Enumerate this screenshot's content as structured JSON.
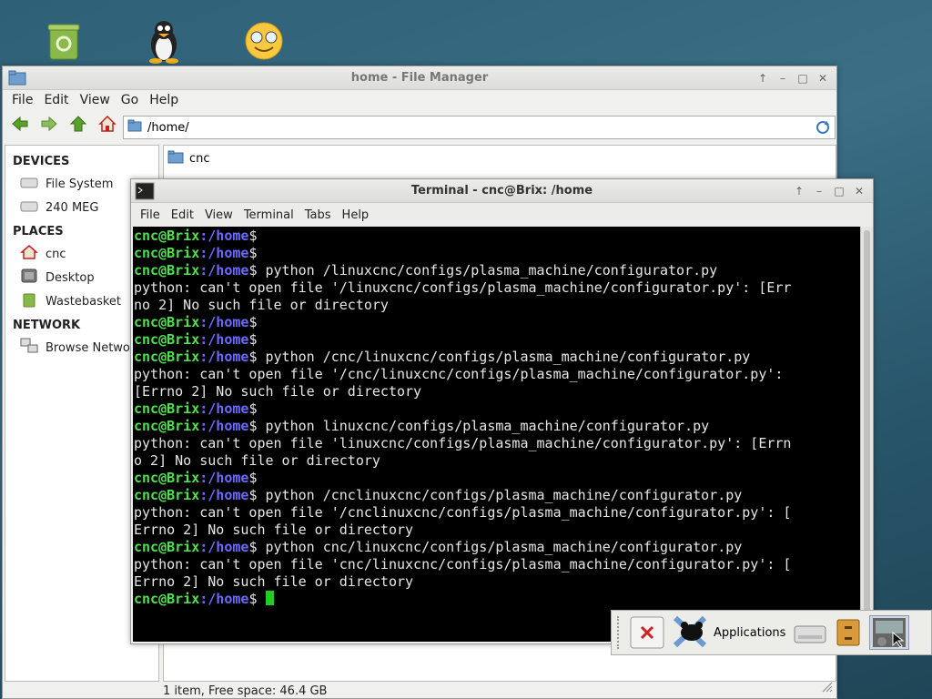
{
  "desktop": {
    "icons": [
      "trash-icon",
      "tux-icon",
      "smiley-icon"
    ]
  },
  "file_manager": {
    "title": "home - File Manager",
    "menu": [
      "File",
      "Edit",
      "View",
      "Go",
      "Help"
    ],
    "path": "/home/",
    "sidebar": {
      "devices_header": "DEVICES",
      "devices": [
        "File System",
        "240 MEG"
      ],
      "places_header": "PLACES",
      "places": [
        "cnc",
        "Desktop",
        "Wastebasket"
      ],
      "network_header": "NETWORK",
      "network": [
        "Browse Network"
      ]
    },
    "items": [
      "cnc"
    ],
    "status": "1 item, Free space: 46.4 GB"
  },
  "terminal": {
    "title": "Terminal - cnc@Brix: /home",
    "menu": [
      "File",
      "Edit",
      "View",
      "Terminal",
      "Tabs",
      "Help"
    ],
    "prompt_user": "cnc@Brix",
    "prompt_path": ":/home",
    "prompt_sign": "$",
    "lines": [
      {
        "prompt": true,
        "text": ""
      },
      {
        "prompt": true,
        "text": ""
      },
      {
        "prompt": true,
        "text": " python /linuxcnc/configs/plasma_machine/configurator.py"
      },
      {
        "prompt": false,
        "text": "python: can't open file '/linuxcnc/configs/plasma_machine/configurator.py': [Err"
      },
      {
        "prompt": false,
        "text": "no 2] No such file or directory"
      },
      {
        "prompt": true,
        "text": ""
      },
      {
        "prompt": true,
        "text": ""
      },
      {
        "prompt": true,
        "text": " python /cnc/linuxcnc/configs/plasma_machine/configurator.py"
      },
      {
        "prompt": false,
        "text": "python: can't open file '/cnc/linuxcnc/configs/plasma_machine/configurator.py':"
      },
      {
        "prompt": false,
        "text": "[Errno 2] No such file or directory"
      },
      {
        "prompt": true,
        "text": ""
      },
      {
        "prompt": true,
        "text": " python linuxcnc/configs/plasma_machine/configurator.py"
      },
      {
        "prompt": false,
        "text": "python: can't open file 'linuxcnc/configs/plasma_machine/configurator.py': [Errn"
      },
      {
        "prompt": false,
        "text": "o 2] No such file or directory"
      },
      {
        "prompt": true,
        "text": ""
      },
      {
        "prompt": true,
        "text": " python /cnclinuxcnc/configs/plasma_machine/configurator.py"
      },
      {
        "prompt": false,
        "text": "python: can't open file '/cnclinuxcnc/configs/plasma_machine/configurator.py': ["
      },
      {
        "prompt": false,
        "text": "Errno 2] No such file or directory"
      },
      {
        "prompt": true,
        "text": " python cnc/linuxcnc/configs/plasma_machine/configurator.py"
      },
      {
        "prompt": false,
        "text": "python: can't open file 'cnc/linuxcnc/configs/plasma_machine/configurator.py': ["
      },
      {
        "prompt": false,
        "text": "Errno 2] No such file or directory"
      },
      {
        "prompt": true,
        "text": " ",
        "cursor": true
      }
    ]
  },
  "panel": {
    "applications_label": "Applications"
  },
  "colors": {
    "prompt_user": "#4ee04e",
    "prompt_path": "#6a6aff",
    "terminal_bg": "#000000",
    "cursor": "#22cc22"
  }
}
